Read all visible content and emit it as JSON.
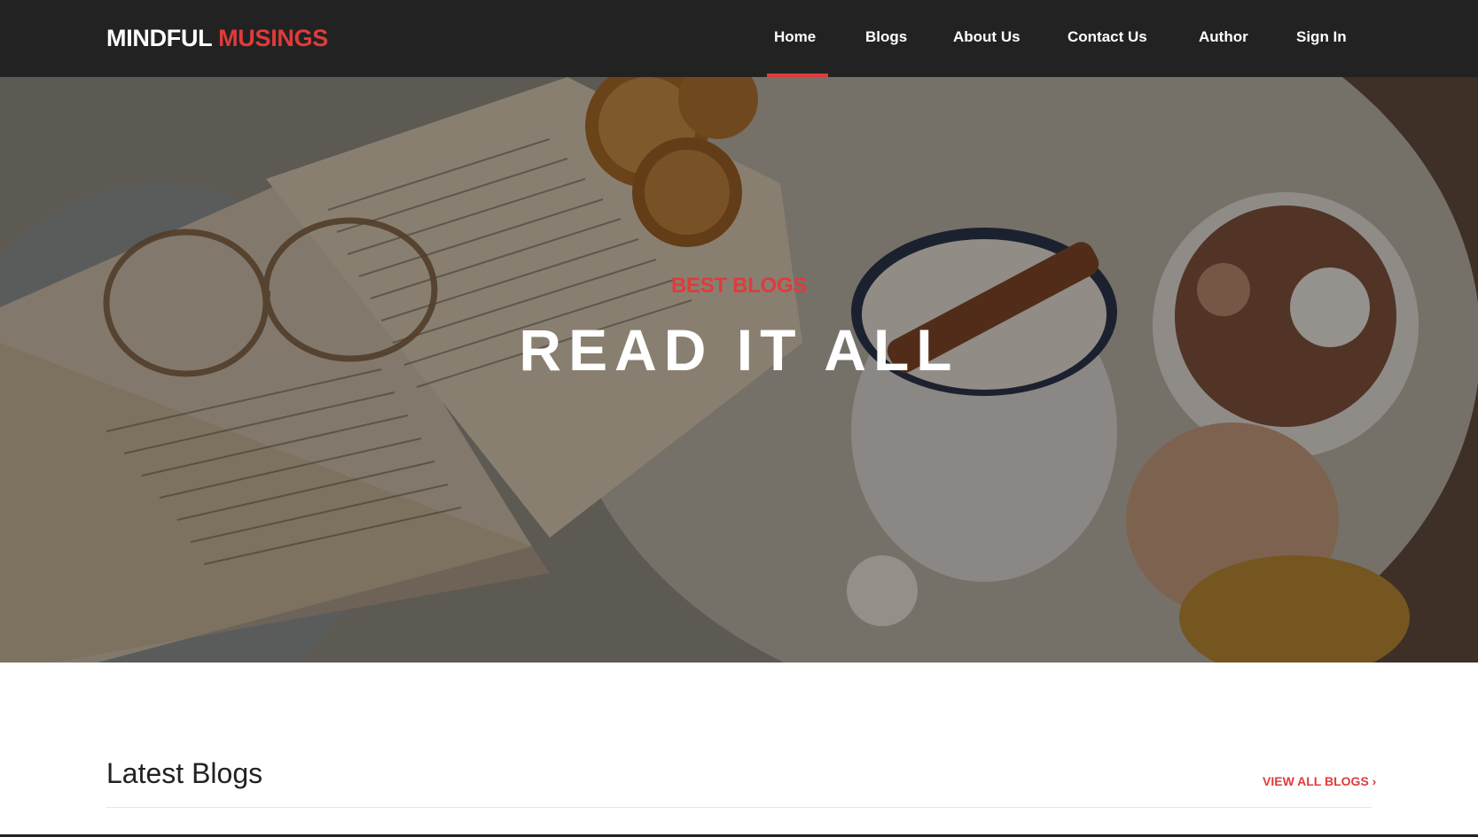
{
  "brand": {
    "part1": "MINDFUL",
    "part2": "MUSINGS"
  },
  "nav": {
    "items": [
      {
        "label": "Home",
        "active": true
      },
      {
        "label": "Blogs"
      },
      {
        "label": "About Us"
      },
      {
        "label": "Contact Us"
      },
      {
        "label": "Author"
      },
      {
        "label": "Sign In"
      }
    ]
  },
  "hero": {
    "kicker": "BEST BLOGS",
    "title": "READ IT ALL"
  },
  "latest": {
    "title": "Latest Blogs",
    "view_all": "VIEW ALL BLOGS ›"
  },
  "colors": {
    "accent": "#e03b3b",
    "header_bg": "#222222",
    "text": "#222222"
  }
}
